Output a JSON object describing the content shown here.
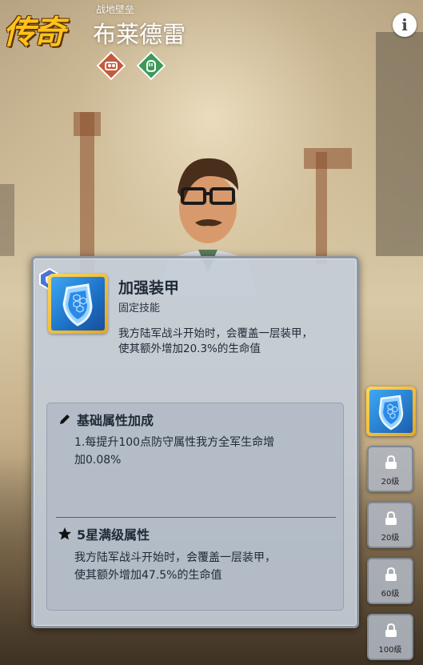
{
  "header": {
    "rarity": "传奇",
    "faction": "战地壁垒",
    "hero_name": "布莱德雷"
  },
  "traits": [
    {
      "icon": "fortress-trait-icon",
      "color": "#c45a3c"
    },
    {
      "icon": "fist-trait-icon",
      "color": "#3d9a58"
    }
  ],
  "info_button": {
    "label": "i"
  },
  "skill": {
    "name": "加强装甲",
    "type": "固定技能",
    "description_line1": "我方陆军战斗开始时，会覆盖一层装甲，",
    "description_line2": "使其额外增加20.3%的生命值",
    "icon": "shield-skill-icon"
  },
  "basic_attribute": {
    "title": "基础属性加成",
    "line1": "1.每提升100点防守属性我方全军生命增",
    "line2": "加0.08%"
  },
  "five_star": {
    "title": "5星满级属性",
    "line1": "我方陆军战斗开始时，会覆盖一层装甲，",
    "line2": "使其额外增加47.5%的生命值"
  },
  "skill_slots": [
    {
      "state": "active",
      "icon": "shield-skill-icon"
    },
    {
      "state": "locked",
      "level": "20级"
    },
    {
      "state": "locked",
      "level": "20级"
    },
    {
      "state": "locked",
      "level": "60级"
    },
    {
      "state": "locked",
      "level": "100级"
    }
  ],
  "colors": {
    "legendary_gold": "#ffc21a",
    "panel_bg": "#c4ccd6",
    "skill_blue": "#3ea7f4"
  }
}
